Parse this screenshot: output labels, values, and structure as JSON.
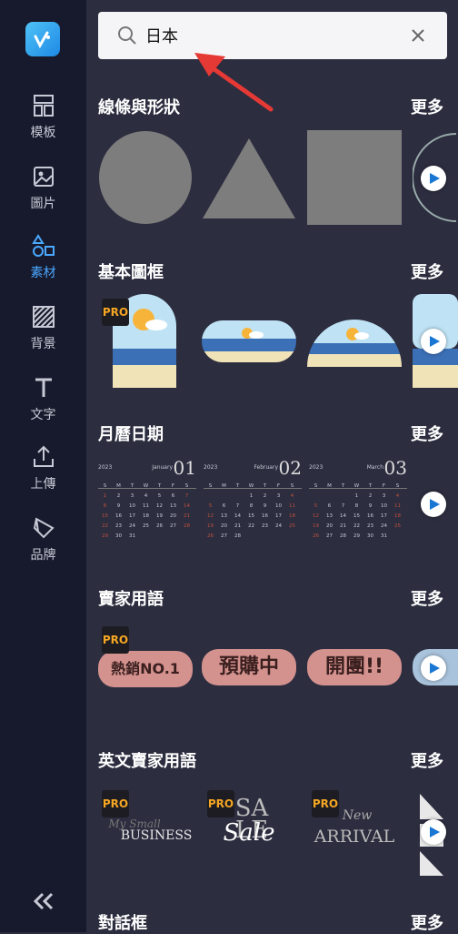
{
  "sidebar": {
    "items": [
      {
        "label": "模板",
        "icon": "template-icon"
      },
      {
        "label": "圖片",
        "icon": "image-icon"
      },
      {
        "label": "素材",
        "icon": "elements-icon"
      },
      {
        "label": "背景",
        "icon": "background-icon"
      },
      {
        "label": "文字",
        "icon": "text-icon"
      },
      {
        "label": "上傳",
        "icon": "upload-icon"
      },
      {
        "label": "品牌",
        "icon": "brand-icon"
      }
    ],
    "active_index": 2,
    "collapse_icon": "double-chevron-left-icon"
  },
  "search": {
    "value": "日本",
    "placeholder": ""
  },
  "sections": [
    {
      "title": "線條與形狀",
      "more": "更多"
    },
    {
      "title": "基本圖框",
      "more": "更多"
    },
    {
      "title": "月曆日期",
      "more": "更多"
    },
    {
      "title": "賣家用語",
      "more": "更多"
    },
    {
      "title": "英文賣家用語",
      "more": "更多"
    },
    {
      "title": "對話框",
      "more": "更多"
    }
  ],
  "badges": {
    "pro": "PRO"
  },
  "calendars": [
    {
      "year": "2023",
      "month_name": "January",
      "month_num": "01",
      "weekdays": [
        "S",
        "M",
        "T",
        "W",
        "T",
        "F",
        "S"
      ],
      "rows": [
        [
          "1",
          "2",
          "3",
          "4",
          "5",
          "6",
          "7"
        ],
        [
          "8",
          "9",
          "10",
          "11",
          "12",
          "13",
          "14"
        ],
        [
          "15",
          "16",
          "17",
          "18",
          "19",
          "20",
          "21"
        ],
        [
          "22",
          "23",
          "24",
          "25",
          "26",
          "27",
          "28"
        ],
        [
          "29",
          "30",
          "31",
          "",
          "",
          "",
          ""
        ]
      ]
    },
    {
      "year": "2023",
      "month_name": "February",
      "month_num": "02",
      "weekdays": [
        "S",
        "M",
        "T",
        "W",
        "T",
        "F",
        "S"
      ],
      "rows": [
        [
          "",
          "",
          "",
          "1",
          "2",
          "3",
          "4"
        ],
        [
          "5",
          "6",
          "7",
          "8",
          "9",
          "10",
          "11"
        ],
        [
          "12",
          "13",
          "14",
          "15",
          "16",
          "17",
          "18"
        ],
        [
          "19",
          "20",
          "21",
          "22",
          "23",
          "24",
          "25"
        ],
        [
          "26",
          "27",
          "28",
          "",
          "",
          "",
          ""
        ]
      ]
    },
    {
      "year": "2023",
      "month_name": "March",
      "month_num": "03",
      "weekdays": [
        "S",
        "M",
        "T",
        "W",
        "T",
        "F",
        "S"
      ],
      "rows": [
        [
          "",
          "",
          "",
          "1",
          "2",
          "3",
          "4"
        ],
        [
          "5",
          "6",
          "7",
          "8",
          "9",
          "10",
          "11"
        ],
        [
          "12",
          "13",
          "14",
          "15",
          "16",
          "17",
          "18"
        ],
        [
          "19",
          "20",
          "21",
          "22",
          "23",
          "24",
          "25"
        ],
        [
          "26",
          "27",
          "28",
          "29",
          "30",
          "31",
          ""
        ]
      ]
    }
  ],
  "phrases": [
    "熱銷NO.1",
    "預購中",
    "開團!!"
  ],
  "english_phrases": [
    {
      "small": "My Small",
      "big": "BUSINESS"
    },
    {
      "small": "Sale",
      "big": "SALE"
    },
    {
      "small": "New",
      "big": "ARRIVAL"
    }
  ],
  "colors": {
    "accent": "#4aa8ff",
    "sidebar_bg": "#171a2c",
    "panel_bg": "#2c2d3f",
    "arrow": "#e53935"
  }
}
